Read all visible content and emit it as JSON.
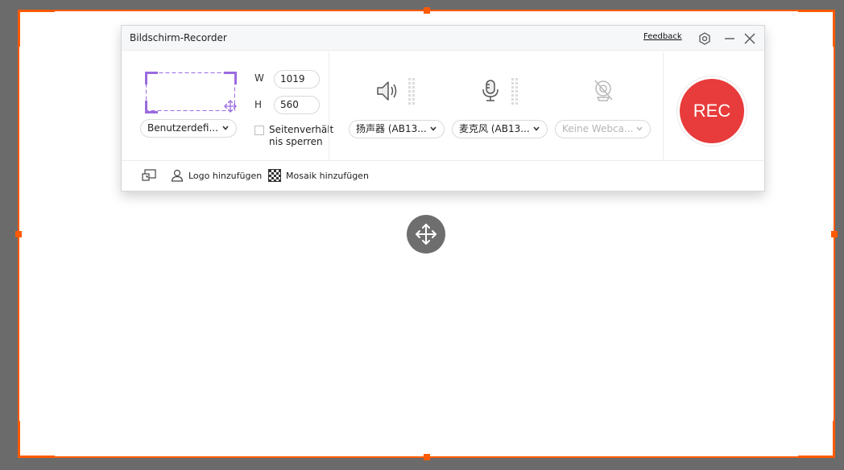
{
  "window": {
    "title": "Bildschirm-Recorder",
    "feedback": "Feedback"
  },
  "region": {
    "mode": "Benutzerdefi...",
    "width_label": "W",
    "width": "1019",
    "height_label": "H",
    "height": "560",
    "lock_aspect_label": "Seitenverhält nis sperren",
    "lock_aspect_checked": false
  },
  "audio": {
    "speaker": "扬声器 (AB13...",
    "microphone": "麦克风 (AB13...",
    "webcam": "Keine Webca..."
  },
  "rec_label": "REC",
  "bottom": {
    "logo": "Logo hinzufügen",
    "mosaic": "Mosaik hinzufügen"
  },
  "colors": {
    "accent": "#ff5a00",
    "rec": "#e83b3b",
    "region_outline": "#9b6be0"
  },
  "icons": [
    "settings-icon",
    "minimize-icon",
    "close-icon",
    "speaker-icon",
    "microphone-icon",
    "webcam-off-icon",
    "move-icon",
    "pip-icon",
    "user-logo-icon",
    "mosaic-icon"
  ]
}
